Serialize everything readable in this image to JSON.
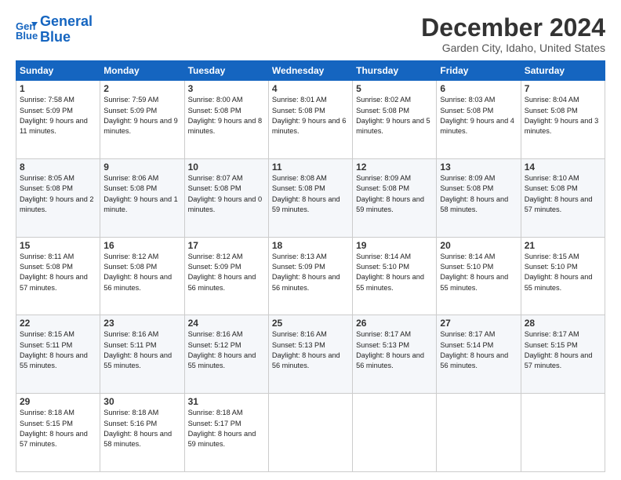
{
  "logo": {
    "line1": "General",
    "line2": "Blue"
  },
  "title": "December 2024",
  "location": "Garden City, Idaho, United States",
  "days_of_week": [
    "Sunday",
    "Monday",
    "Tuesday",
    "Wednesday",
    "Thursday",
    "Friday",
    "Saturday"
  ],
  "weeks": [
    [
      {
        "day": 1,
        "sunrise": "7:58 AM",
        "sunset": "5:09 PM",
        "daylight": "9 hours and 11 minutes."
      },
      {
        "day": 2,
        "sunrise": "7:59 AM",
        "sunset": "5:09 PM",
        "daylight": "9 hours and 9 minutes."
      },
      {
        "day": 3,
        "sunrise": "8:00 AM",
        "sunset": "5:08 PM",
        "daylight": "9 hours and 8 minutes."
      },
      {
        "day": 4,
        "sunrise": "8:01 AM",
        "sunset": "5:08 PM",
        "daylight": "9 hours and 6 minutes."
      },
      {
        "day": 5,
        "sunrise": "8:02 AM",
        "sunset": "5:08 PM",
        "daylight": "9 hours and 5 minutes."
      },
      {
        "day": 6,
        "sunrise": "8:03 AM",
        "sunset": "5:08 PM",
        "daylight": "9 hours and 4 minutes."
      },
      {
        "day": 7,
        "sunrise": "8:04 AM",
        "sunset": "5:08 PM",
        "daylight": "9 hours and 3 minutes."
      }
    ],
    [
      {
        "day": 8,
        "sunrise": "8:05 AM",
        "sunset": "5:08 PM",
        "daylight": "9 hours and 2 minutes."
      },
      {
        "day": 9,
        "sunrise": "8:06 AM",
        "sunset": "5:08 PM",
        "daylight": "9 hours and 1 minute."
      },
      {
        "day": 10,
        "sunrise": "8:07 AM",
        "sunset": "5:08 PM",
        "daylight": "9 hours and 0 minutes."
      },
      {
        "day": 11,
        "sunrise": "8:08 AM",
        "sunset": "5:08 PM",
        "daylight": "8 hours and 59 minutes."
      },
      {
        "day": 12,
        "sunrise": "8:09 AM",
        "sunset": "5:08 PM",
        "daylight": "8 hours and 59 minutes."
      },
      {
        "day": 13,
        "sunrise": "8:09 AM",
        "sunset": "5:08 PM",
        "daylight": "8 hours and 58 minutes."
      },
      {
        "day": 14,
        "sunrise": "8:10 AM",
        "sunset": "5:08 PM",
        "daylight": "8 hours and 57 minutes."
      }
    ],
    [
      {
        "day": 15,
        "sunrise": "8:11 AM",
        "sunset": "5:08 PM",
        "daylight": "8 hours and 57 minutes."
      },
      {
        "day": 16,
        "sunrise": "8:12 AM",
        "sunset": "5:08 PM",
        "daylight": "8 hours and 56 minutes."
      },
      {
        "day": 17,
        "sunrise": "8:12 AM",
        "sunset": "5:09 PM",
        "daylight": "8 hours and 56 minutes."
      },
      {
        "day": 18,
        "sunrise": "8:13 AM",
        "sunset": "5:09 PM",
        "daylight": "8 hours and 56 minutes."
      },
      {
        "day": 19,
        "sunrise": "8:14 AM",
        "sunset": "5:10 PM",
        "daylight": "8 hours and 55 minutes."
      },
      {
        "day": 20,
        "sunrise": "8:14 AM",
        "sunset": "5:10 PM",
        "daylight": "8 hours and 55 minutes."
      },
      {
        "day": 21,
        "sunrise": "8:15 AM",
        "sunset": "5:10 PM",
        "daylight": "8 hours and 55 minutes."
      }
    ],
    [
      {
        "day": 22,
        "sunrise": "8:15 AM",
        "sunset": "5:11 PM",
        "daylight": "8 hours and 55 minutes."
      },
      {
        "day": 23,
        "sunrise": "8:16 AM",
        "sunset": "5:11 PM",
        "daylight": "8 hours and 55 minutes."
      },
      {
        "day": 24,
        "sunrise": "8:16 AM",
        "sunset": "5:12 PM",
        "daylight": "8 hours and 55 minutes."
      },
      {
        "day": 25,
        "sunrise": "8:16 AM",
        "sunset": "5:13 PM",
        "daylight": "8 hours and 56 minutes."
      },
      {
        "day": 26,
        "sunrise": "8:17 AM",
        "sunset": "5:13 PM",
        "daylight": "8 hours and 56 minutes."
      },
      {
        "day": 27,
        "sunrise": "8:17 AM",
        "sunset": "5:14 PM",
        "daylight": "8 hours and 56 minutes."
      },
      {
        "day": 28,
        "sunrise": "8:17 AM",
        "sunset": "5:15 PM",
        "daylight": "8 hours and 57 minutes."
      }
    ],
    [
      {
        "day": 29,
        "sunrise": "8:18 AM",
        "sunset": "5:15 PM",
        "daylight": "8 hours and 57 minutes."
      },
      {
        "day": 30,
        "sunrise": "8:18 AM",
        "sunset": "5:16 PM",
        "daylight": "8 hours and 58 minutes."
      },
      {
        "day": 31,
        "sunrise": "8:18 AM",
        "sunset": "5:17 PM",
        "daylight": "8 hours and 59 minutes."
      },
      null,
      null,
      null,
      null
    ]
  ]
}
